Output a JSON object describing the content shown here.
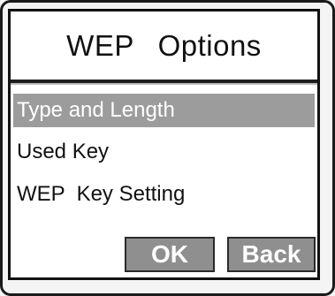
{
  "screen": {
    "title": "WEP  Options"
  },
  "menu": {
    "items": [
      {
        "label": "Type and Length",
        "selected": true
      },
      {
        "label": "Used Key",
        "selected": false
      },
      {
        "label": "WEP  Key Setting",
        "selected": false
      }
    ]
  },
  "softkeys": {
    "ok_label": "OK",
    "back_label": "Back"
  },
  "colors": {
    "highlight": "#9c9c9c",
    "button": "#8f8f8f",
    "border": "#111111"
  }
}
